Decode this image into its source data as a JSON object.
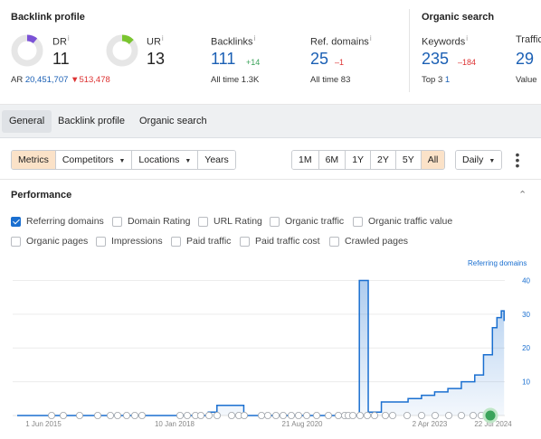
{
  "backlink_profile": {
    "title": "Backlink profile",
    "dr": {
      "label": "DR",
      "info": "i",
      "value": "11",
      "fill": 0.11,
      "color": "#7b52d6"
    },
    "ur": {
      "label": "UR",
      "info": "i",
      "value": "13",
      "fill": 0.13,
      "color": "#7ac52f"
    },
    "ar": {
      "label": "AR",
      "value": "20,451,707",
      "delta": "513,478"
    },
    "backlinks": {
      "label": "Backlinks",
      "info": "i",
      "value": "111",
      "delta": "+14",
      "sub": "All time 1.3K"
    },
    "ref_domains": {
      "label": "Ref. domains",
      "info": "i",
      "value": "25",
      "delta": "–1",
      "sub_label": "All time",
      "sub_value": "83"
    }
  },
  "organic_search": {
    "title": "Organic search",
    "keywords": {
      "label": "Keywords",
      "info": "i",
      "value": "235",
      "delta": "–184",
      "sub_label": "Top 3",
      "sub_value": "1"
    },
    "traffic": {
      "label": "Traffic",
      "value": "29",
      "sub": "Value"
    }
  },
  "tabs": [
    {
      "label": "General",
      "active": true
    },
    {
      "label": "Backlink profile",
      "active": false
    },
    {
      "label": "Organic search",
      "active": false
    }
  ],
  "toolbar": {
    "metrics": "Metrics",
    "competitors": "Competitors",
    "locations": "Locations",
    "years": "Years",
    "ranges": [
      "1M",
      "6M",
      "1Y",
      "2Y",
      "5Y",
      "All"
    ],
    "active_range": "All",
    "interval": "Daily"
  },
  "performance": {
    "title": "Performance",
    "checkboxes_row1": [
      {
        "label": "Referring domains",
        "checked": true
      },
      {
        "label": "Domain Rating",
        "checked": false
      },
      {
        "label": "URL Rating",
        "checked": false
      },
      {
        "label": "Organic traffic",
        "checked": false
      },
      {
        "label": "Organic traffic value",
        "checked": false
      }
    ],
    "checkboxes_row2": [
      {
        "label": "Organic pages",
        "checked": false
      },
      {
        "label": "Impressions",
        "checked": false
      },
      {
        "label": "Paid traffic",
        "checked": false
      },
      {
        "label": "Paid traffic cost",
        "checked": false
      },
      {
        "label": "Crawled pages",
        "checked": false
      }
    ]
  },
  "colors": {
    "accent": "#1a6fd0",
    "negative": "#dd3333",
    "positive": "#3aa35a",
    "active_button": "#fbe2c8"
  },
  "chart_data": {
    "type": "area",
    "series": [
      {
        "name": "Referring domains",
        "x": [
          "2015-06-01",
          "2016-06-01",
          "2017-06-01",
          "2018-06-01",
          "2019-01-01",
          "2019-03-01",
          "2019-06-01",
          "2019-09-01",
          "2020-01-01",
          "2020-06-01",
          "2021-01-01",
          "2021-06-01",
          "2021-10-01",
          "2021-11-01",
          "2021-12-01",
          "2022-01-01",
          "2022-04-01",
          "2022-07-01",
          "2022-10-01",
          "2023-01-01",
          "2023-04-01",
          "2023-07-01",
          "2023-10-01",
          "2024-01-01",
          "2024-03-01",
          "2024-05-01",
          "2024-06-01",
          "2024-07-01",
          "2024-07-20"
        ],
        "values": [
          0,
          0,
          0,
          0,
          1,
          3,
          3,
          0,
          0,
          0,
          0,
          0,
          0,
          40,
          40,
          1,
          4,
          4,
          5,
          6,
          7,
          8,
          10,
          12,
          18,
          26,
          29,
          31,
          28
        ]
      }
    ],
    "x_ticks": [
      "1 Jun 2015",
      "10 Jan 2018",
      "21 Aug 2020",
      "2 Apr 2023",
      "22 Jul 2024"
    ],
    "y_ticks": [
      10,
      20,
      30,
      40
    ],
    "ylim": [
      0,
      42
    ],
    "right_axis_label": "Referring domains",
    "grid": true
  }
}
